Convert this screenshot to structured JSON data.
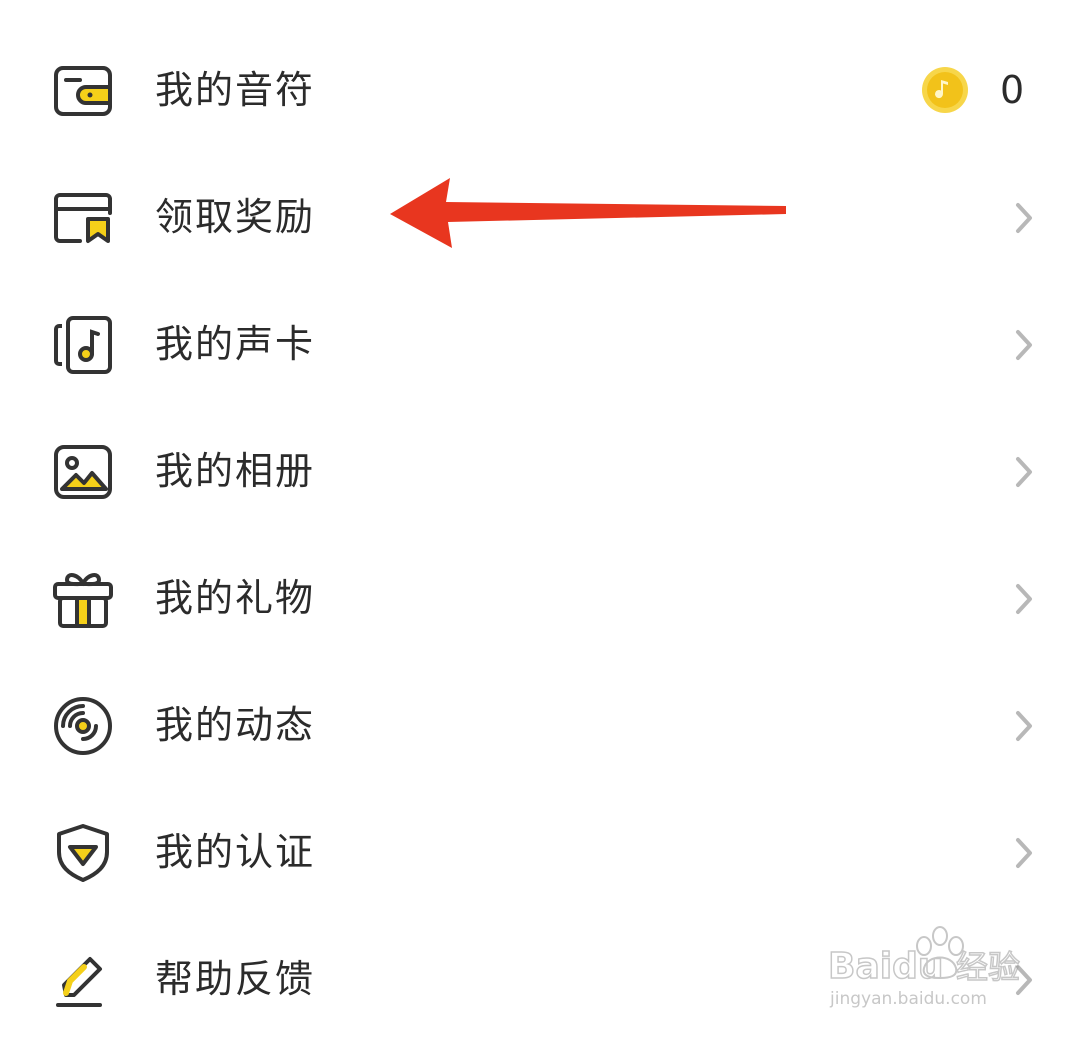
{
  "menu": {
    "items": [
      {
        "label": "我的音符",
        "icon": "wallet-icon",
        "value": "0"
      },
      {
        "label": "领取奖励",
        "icon": "reward-bookmark-icon"
      },
      {
        "label": "我的声卡",
        "icon": "sound-card-icon"
      },
      {
        "label": "我的相册",
        "icon": "photo-album-icon"
      },
      {
        "label": "我的礼物",
        "icon": "gift-icon"
      },
      {
        "label": "我的动态",
        "icon": "vinyl-record-icon"
      },
      {
        "label": "我的认证",
        "icon": "shield-check-icon"
      },
      {
        "label": "帮助反馈",
        "icon": "pencil-icon"
      }
    ]
  },
  "watermark": {
    "brand": "Baidu",
    "text": "经验",
    "url": "jingyan.baidu.com"
  },
  "colors": {
    "accent": "#f5d019",
    "text": "#2b2b2b",
    "icon_stroke": "#333333",
    "chevron": "#b8b8b8",
    "arrow": "#e8361f"
  }
}
